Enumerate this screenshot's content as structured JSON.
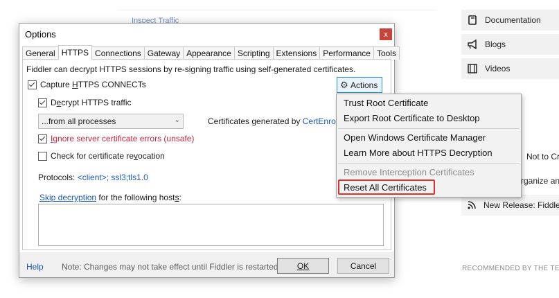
{
  "background": {
    "inspect_link": "Inspect Traffic",
    "right_items": [
      {
        "label": "Documentation",
        "icon": "book-icon"
      },
      {
        "label": "Blogs",
        "icon": "megaphone-icon"
      },
      {
        "label": "Videos",
        "icon": "film-icon"
      }
    ],
    "fragments": [
      "Not to Cre",
      "rganize and"
    ],
    "release_item": "New Release: Fiddler",
    "recommended": "RECOMMENDED BY THE TEA"
  },
  "dialog": {
    "title": "Options",
    "close_glyph": "x",
    "tabs": [
      "General",
      "HTTPS",
      "Connections",
      "Gateway",
      "Appearance",
      "Scripting",
      "Extensions",
      "Performance",
      "Tools"
    ],
    "active_tab": "HTTPS",
    "description": "Fiddler can decrypt HTTPS sessions by re-signing traffic using self-generated certificates.",
    "capture_label_pre": "Capture ",
    "capture_label_key": "H",
    "capture_label_post": "TTPS CONNECTs",
    "decrypt_label_pre": "D",
    "decrypt_label_key": "e",
    "decrypt_label_post": "crypt HTTPS traffic",
    "process_filter": "...from all processes",
    "ignore_label_key": "I",
    "ignore_label_post": "gnore server certificate errors (unsafe)",
    "revocation_label_pre": "Check for certificate re",
    "revocation_label_key": "v",
    "revocation_label_post": "ocation",
    "certs_generated_pre": "Certificates generated by ",
    "certs_generated_link": "CertEnroll e",
    "protocols_label": "Protocols: ",
    "protocols_value": "<client>; ssl3;tls1.0",
    "skip_link": "Skip decryption",
    "skip_post": " for the following host",
    "skip_key": "s",
    "skip_colon": ":",
    "actions_label": "Actions",
    "help": "Help",
    "note": "Note: Changes may not take effect until Fiddler is restarted.",
    "ok": "OK",
    "cancel": "Cancel",
    "checkboxes": {
      "capture": true,
      "decrypt": true,
      "ignore": true,
      "revocation": false
    }
  },
  "menu": {
    "items": [
      {
        "label": "Trust Root Certificate",
        "enabled": true
      },
      {
        "label": "Export Root Certificate to Desktop",
        "enabled": true
      },
      {
        "label": "Open Windows Certificate Manager",
        "enabled": true
      },
      {
        "label": "Learn More about HTTPS Decryption",
        "enabled": true
      },
      {
        "label": "Remove Interception Certificates",
        "enabled": false
      },
      {
        "label": "Reset All Certificates",
        "enabled": true,
        "highlighted": true
      }
    ]
  },
  "colors": {
    "accent_blue": "#1a56b8",
    "warning_red": "#c7263e",
    "highlight_red": "#e0322c",
    "close_red": "#c7443a"
  }
}
